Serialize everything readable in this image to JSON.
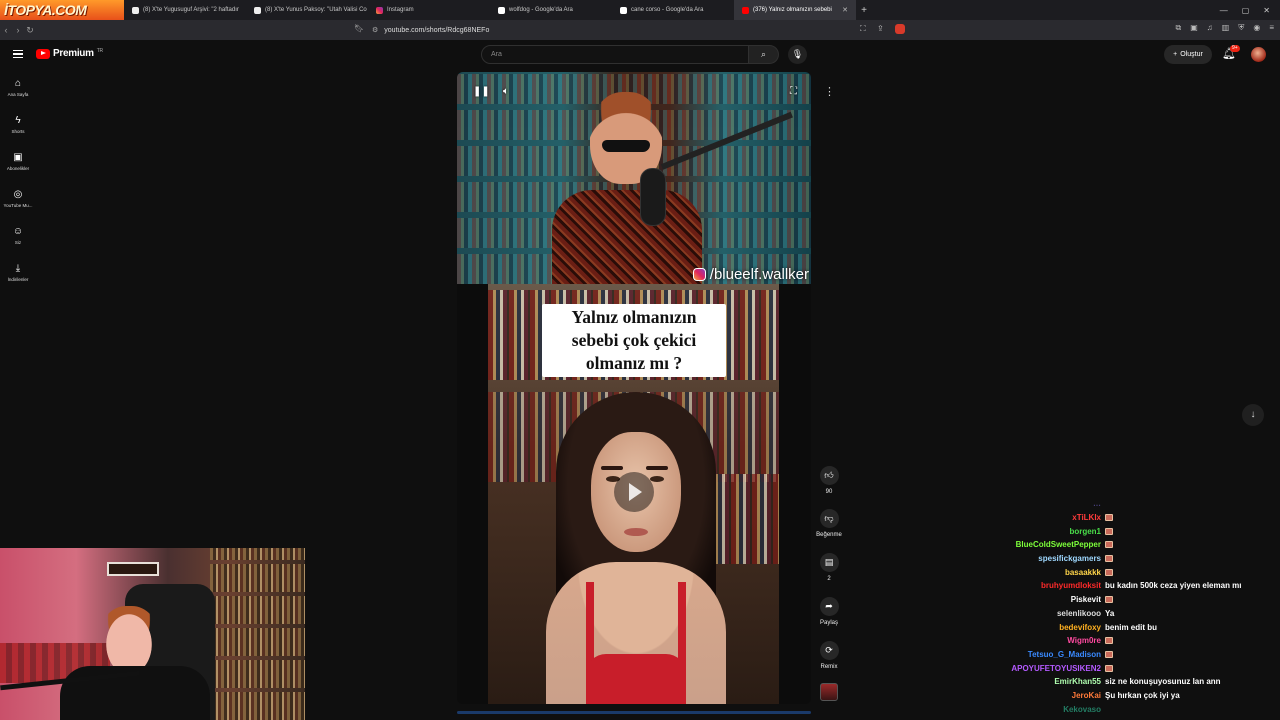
{
  "watermark": "İTOPYA.COM",
  "tabs": [
    {
      "label": "(8) X'te Yugusuguf Arşivi: \"2 haftadır",
      "icon": "x-icon"
    },
    {
      "label": "(8) X'te Yunus Paksoy: \"Utah Valisi Co",
      "icon": "x-icon"
    },
    {
      "label": "Instagram",
      "icon": "instagram-icon"
    },
    {
      "label": "wolfdog - Google'da Ara",
      "icon": "google-icon"
    },
    {
      "label": "cane corso - Google'da Ara",
      "icon": "google-icon"
    },
    {
      "label": "(376) Yalnız olmanızın sebebi",
      "icon": "youtube-icon",
      "active": true
    }
  ],
  "address": {
    "url": "youtube.com/shorts/Rdcg68NEFo"
  },
  "header": {
    "brand": "Premium",
    "region": "TR",
    "search_placeholder": "Ara",
    "create_label": "Oluştur",
    "notif_count": "9+"
  },
  "sidebar": [
    {
      "label": "Ana Sayfa",
      "icon": "home-icon"
    },
    {
      "label": "Shorts",
      "icon": "shorts-icon"
    },
    {
      "label": "Abonelikler",
      "icon": "subscriptions-icon"
    },
    {
      "label": "YouTube Mu...",
      "icon": "youtube-music-icon"
    },
    {
      "label": "Siz",
      "icon": "profile-icon"
    },
    {
      "label": "İndirilenler",
      "icon": "download-icon"
    }
  ],
  "video": {
    "handle": "/blueelf.wallker",
    "caption_line1": "Yalnız olmanızın",
    "caption_line2": "sebebi çok çekici",
    "caption_line3": "olmanız mı ?"
  },
  "actions": {
    "likes": "90",
    "dislike_label": "Beğenme",
    "comments": "2",
    "share_label": "Paylaş",
    "remix_label": "Remix"
  },
  "chat": [
    {
      "user": "…",
      "color": "#8a7aff",
      "msg": "",
      "emote": false,
      "faded": true
    },
    {
      "user": "xTiLKIx",
      "color": "#ff3b3b",
      "msg": "",
      "emote": true
    },
    {
      "user": "borgen1",
      "color": "#4ade4a",
      "msg": "",
      "emote": true
    },
    {
      "user": "BlueColdSweetPepper",
      "color": "#7dff3a",
      "msg": "",
      "emote": true
    },
    {
      "user": "spesifickgamers",
      "color": "#9fd8ff",
      "msg": "",
      "emote": true
    },
    {
      "user": "basaakkk",
      "color": "#ffd54a",
      "msg": "",
      "emote": true
    },
    {
      "user": "bruhyumdloksit",
      "color": "#ff2a2a",
      "msg": "bu kadın 500k ceza yiyen eleman mı",
      "emote": false
    },
    {
      "user": "Piskevit",
      "color": "#ffffff",
      "msg": "",
      "emote": true
    },
    {
      "user": "selenlikooo",
      "color": "#dddddd",
      "msg": "Ya",
      "emote": false
    },
    {
      "user": "bedevifoxy",
      "color": "#ffb020",
      "msg": "benim edit bu",
      "emote": false
    },
    {
      "user": "Wigm0re",
      "color": "#ff4aa0",
      "msg": "",
      "emote": true
    },
    {
      "user": "Tetsuo_G_Madison",
      "color": "#3a8aff",
      "msg": "",
      "emote": true
    },
    {
      "user": "APOYUFETOYUSIKEN2",
      "color": "#b45aff",
      "msg": "",
      "emote": true
    },
    {
      "user": "EmirKhan55",
      "color": "#b0ffb0",
      "msg": "siz ne konuşuyosunuz lan ann",
      "emote": false
    },
    {
      "user": "JeroKai",
      "color": "#ff7a3a",
      "msg": "Şu hırkan çok iyi ya",
      "emote": false
    },
    {
      "user": "Kekovaso",
      "color": "#3affc8",
      "msg": "",
      "emote": false,
      "faded": true
    }
  ],
  "colors": {
    "accent": "#ff0000",
    "background": "#0f0f0f"
  }
}
